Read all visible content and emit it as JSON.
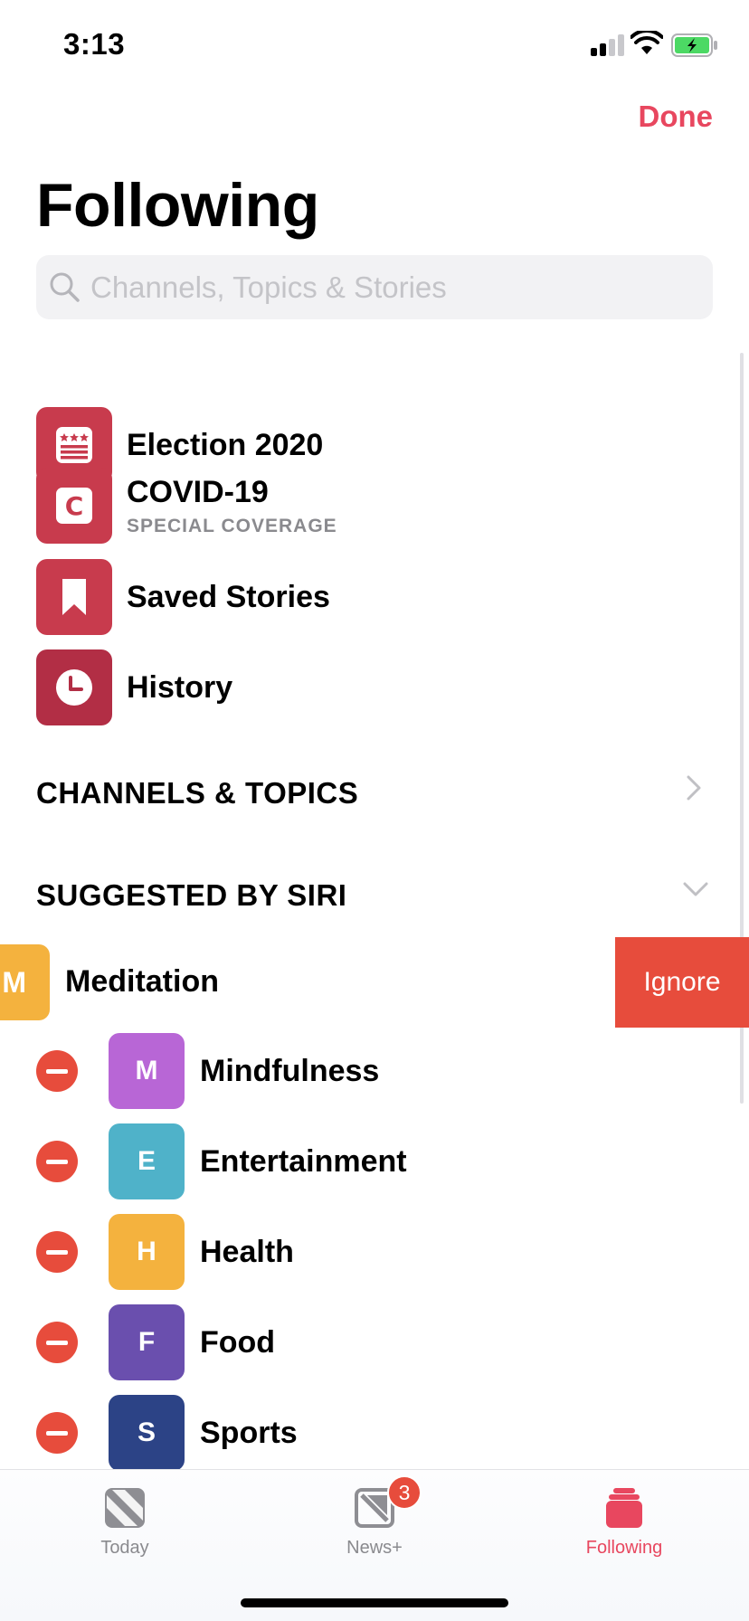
{
  "status": {
    "time": "3:13"
  },
  "header": {
    "done_label": "Done",
    "title": "Following"
  },
  "search": {
    "placeholder": "Channels, Topics & Stories"
  },
  "fixed_items": [
    {
      "label": "Election 2020",
      "sublabel": "",
      "icon": "ballot-icon"
    },
    {
      "label": "COVID-19",
      "sublabel": "SPECIAL COVERAGE",
      "icon": "covid-c-icon"
    },
    {
      "label": "Saved Stories",
      "sublabel": "",
      "icon": "bookmark-icon"
    },
    {
      "label": "History",
      "sublabel": "",
      "icon": "clock-icon"
    }
  ],
  "sections": {
    "channels_topics": "CHANNELS & TOPICS",
    "suggested_by_siri": "SUGGESTED BY SIRI"
  },
  "swiped_item": {
    "letter": "M",
    "label": "Meditation",
    "action_label": "Ignore",
    "color": "#f4b23e"
  },
  "topics": [
    {
      "letter": "M",
      "label": "Mindfulness",
      "color": "#b866d6"
    },
    {
      "letter": "E",
      "label": "Entertainment",
      "color": "#4fb2c9"
    },
    {
      "letter": "H",
      "label": "Health",
      "color": "#f4b23e"
    },
    {
      "letter": "F",
      "label": "Food",
      "color": "#6a4fae"
    },
    {
      "letter": "S",
      "label": "Sports",
      "color": "#2c4386"
    }
  ],
  "tabs": {
    "today": {
      "label": "Today"
    },
    "newsplus": {
      "label": "News+",
      "badge": "3"
    },
    "following": {
      "label": "Following"
    }
  },
  "colors": {
    "accent": "#e8475f",
    "destructive": "#e74c3c",
    "tile_red": "#c83b4d"
  }
}
